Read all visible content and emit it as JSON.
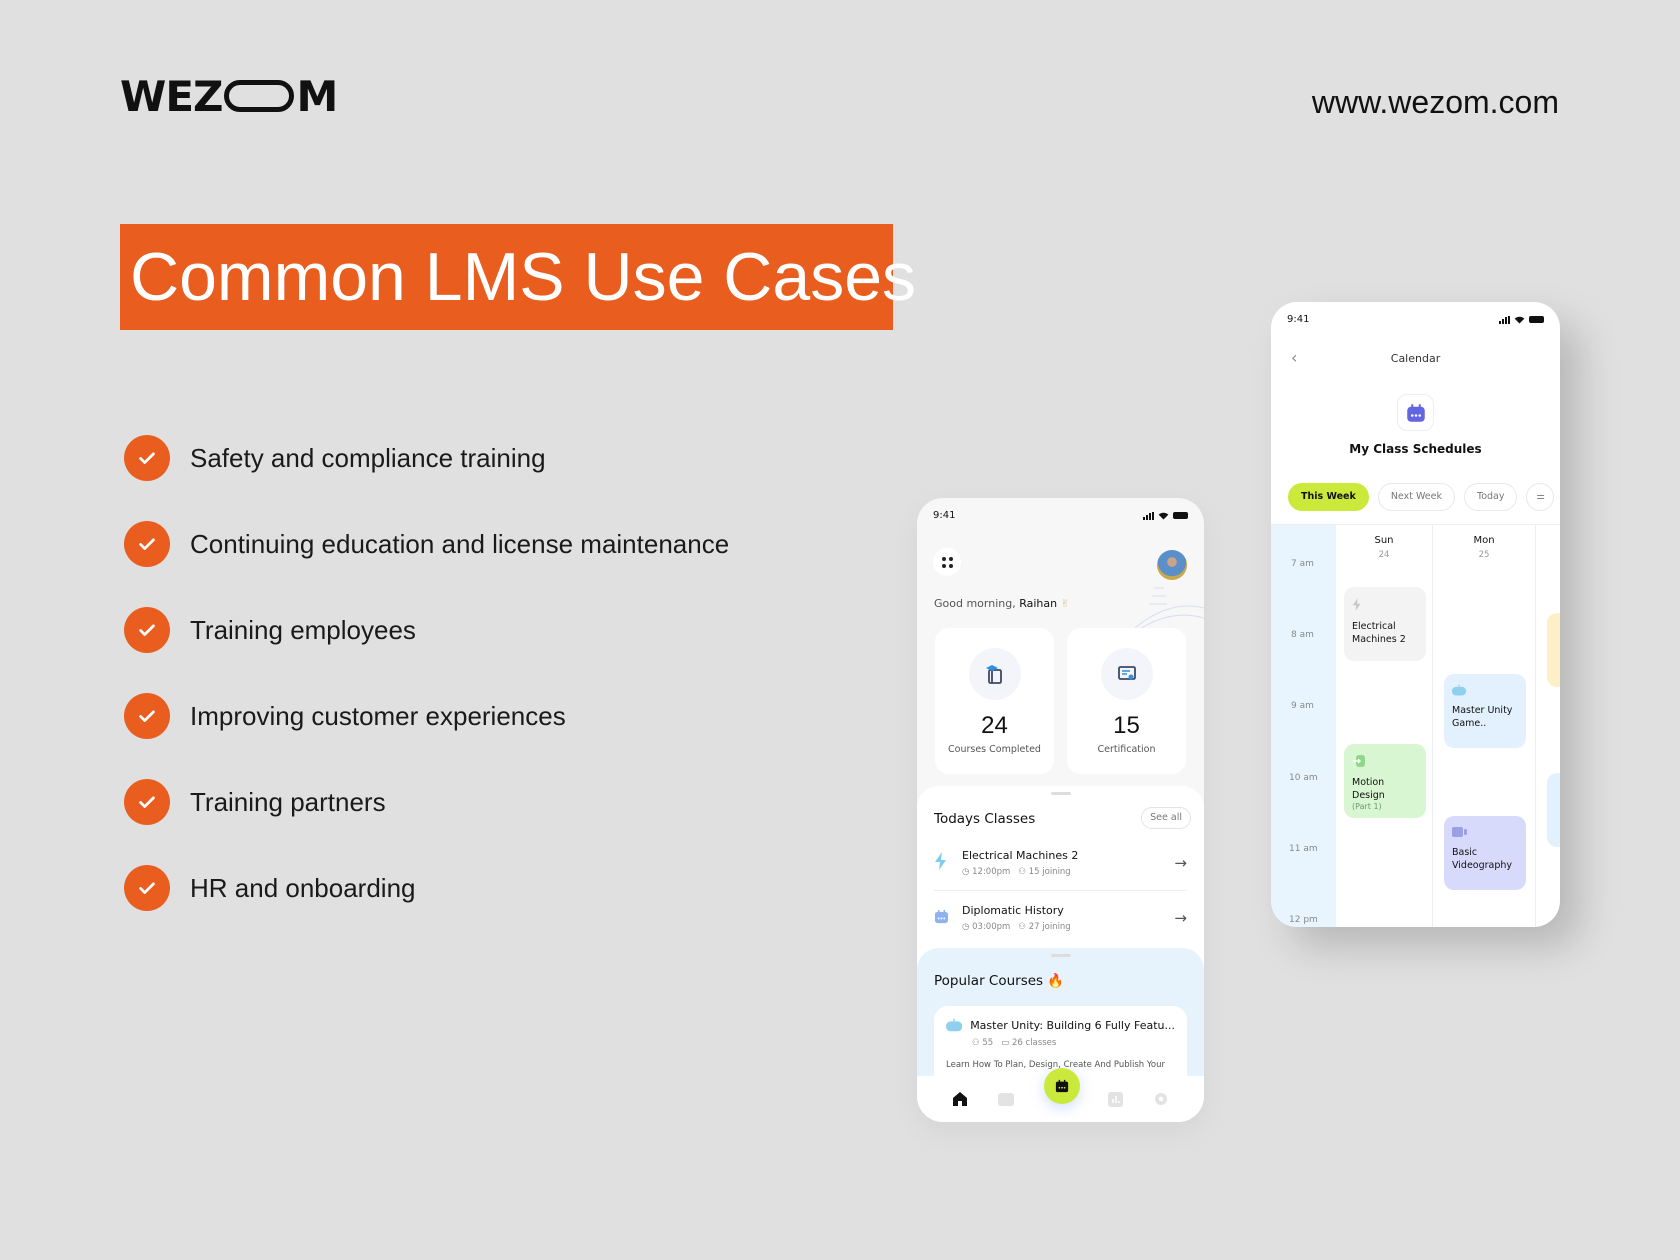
{
  "brand": {
    "logo_text_left": "WEZ",
    "logo_text_right": "M",
    "website": "www.wezom.com",
    "accent_color": "#e95d1e"
  },
  "banner": {
    "title": "Common LMS Use Cases"
  },
  "use_cases": [
    "Safety and compliance training",
    "Continuing education and license maintenance",
    "Training employees",
    "Improving customer experiences",
    "Training partners",
    "HR and onboarding"
  ],
  "home_phone": {
    "status_time": "9:41",
    "greeting_prefix": "Good morning, ",
    "user_name": "Raihan",
    "greeting_emoji": "✌",
    "stats": [
      {
        "value": "24",
        "label": "Courses Completed",
        "icon": "graduation-book-icon"
      },
      {
        "value": "15",
        "label": "Certification",
        "icon": "certificate-icon"
      }
    ],
    "todays_classes": {
      "title": "Todays Classes",
      "see_all": "See all",
      "items": [
        {
          "name": "Electrical Machines 2",
          "time": "12:00pm",
          "joining": "15 joining",
          "icon": "lightning-icon"
        },
        {
          "name": "Diplomatic History",
          "time": "03:00pm",
          "joining": "27 joining",
          "icon": "calendar-icon"
        }
      ]
    },
    "popular_courses": {
      "title": "Popular Courses",
      "emoji": "🔥",
      "course": {
        "name": "Master Unity: Building 6 Fully Featu...",
        "students": "55",
        "classes": "26 classes",
        "description": "Learn How To Plan, Design, Create And Publish Your"
      }
    },
    "tabbar": [
      "home-icon",
      "folder-icon",
      "calendar-icon",
      "chart-icon",
      "settings-icon"
    ],
    "fab_color": "#cbe93a"
  },
  "calendar_phone": {
    "status_time": "9:41",
    "header": "Calendar",
    "title": "My Class Schedules",
    "chips": [
      "This Week",
      "Next Week",
      "Today"
    ],
    "times": [
      "7 am",
      "8 am",
      "9 am",
      "10 am",
      "11 am",
      "12 pm"
    ],
    "days": [
      {
        "name": "Sun",
        "date": "24"
      },
      {
        "name": "Mon",
        "date": "25"
      }
    ],
    "events": [
      {
        "title": "Electrical Machines 2",
        "day": "Sun",
        "color": "#f3f3f3"
      },
      {
        "title": "Master Unity Game..",
        "day": "Mon",
        "color": "#e2f1fd"
      },
      {
        "title": "Motion Design",
        "subtitle": "(Part 1)",
        "day": "Sun",
        "color": "#d9f6d2"
      },
      {
        "title": "Basic Videography",
        "day": "Mon",
        "color": "#d8dafb"
      }
    ]
  }
}
